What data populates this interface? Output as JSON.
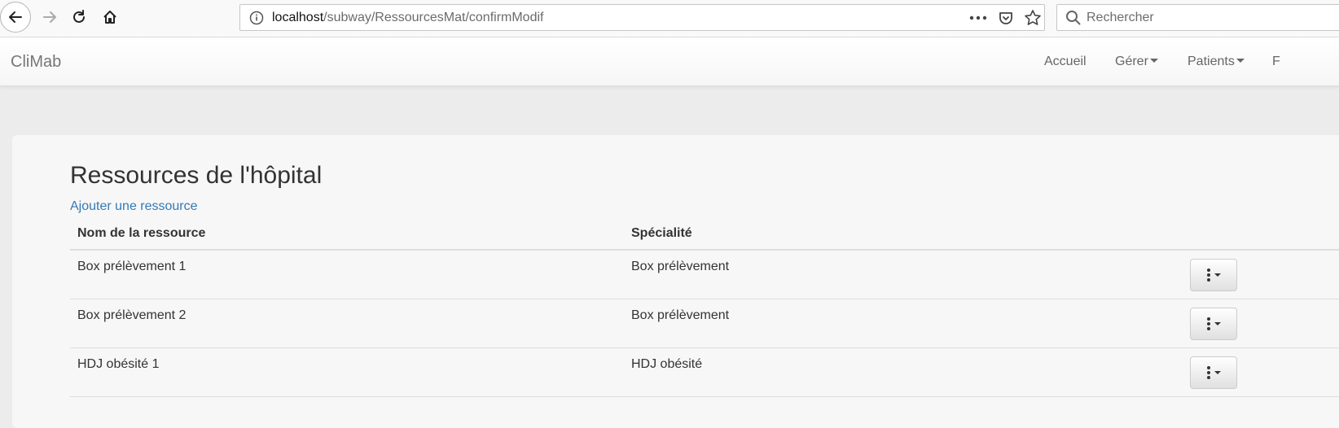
{
  "browser": {
    "url_host": "localhost",
    "url_path": "/subway/RessourcesMat/confirmModif",
    "search_placeholder": "Rechercher"
  },
  "navbar": {
    "brand": "CliMab",
    "links": [
      {
        "label": "Accueil"
      },
      {
        "label": "Gérer"
      },
      {
        "label": "Patients"
      },
      {
        "label": "F"
      }
    ]
  },
  "page": {
    "title": "Ressources de l'hôpital",
    "add_link": "Ajouter une ressource"
  },
  "table": {
    "headers": [
      "Nom de la ressource",
      "Spécialité"
    ],
    "rows": [
      {
        "name": "Box prélèvement 1",
        "specialite": "Box prélèvement"
      },
      {
        "name": "Box prélèvement 2",
        "specialite": "Box prélèvement"
      },
      {
        "name": "HDJ obésité 1",
        "specialite": "HDJ obésité"
      }
    ]
  },
  "colors": {
    "link": "#337ab7",
    "background": "#ececec",
    "panel": "#f7f7f7"
  },
  "icons": [
    "back-arrow-icon",
    "forward-arrow-icon",
    "reload-icon",
    "home-icon",
    "info-icon",
    "more-icon",
    "pocket-icon",
    "bookmark-star-icon",
    "search-icon",
    "kebab-menu-icon",
    "caret-down-icon"
  ]
}
